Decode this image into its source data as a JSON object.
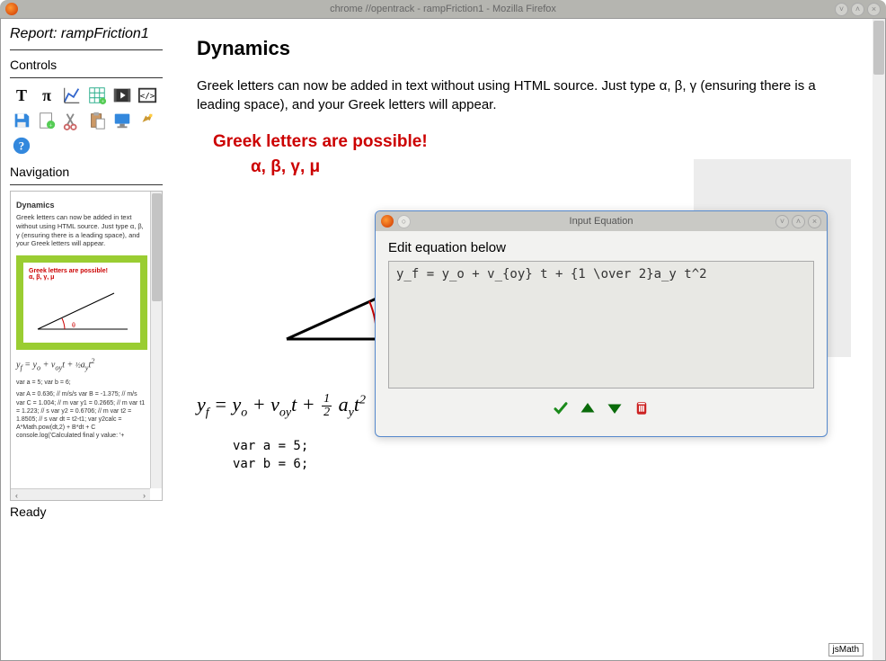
{
  "window": {
    "title": "chrome //opentrack - rampFriction1 - Mozilla Firefox"
  },
  "sidebar": {
    "report_label": "Report: rampFriction1",
    "controls_label": "Controls",
    "navigation_label": "Navigation",
    "status": "Ready"
  },
  "nav": {
    "title": "Dynamics",
    "para": "Greek letters can now be added in text without using HTML source. Just type α, β, γ (ensuring there is a leading space), and your Greek letters will appear.",
    "preview_red1": "Greek letters are possible!",
    "preview_red2": "α, β, γ, μ",
    "preview_angle": "θ",
    "eq": "yf = yo + voyt + ½ayt²",
    "code1": "var a = 5; var b = 6;",
    "code2": "var A = 0.636; // m/s/s var B = -1.375; // m/s var C = 1.004; // m var y1 = 0.2665; // m var t1 = 1.223; // s var y2 = 0.6706; // m var t2 = 1.8505; // s var dt = t2-t1; var y2calc = A*Math.pow(dt,2) + B*dt + C console.log('Calculated final y value: '+"
  },
  "main": {
    "heading": "Dynamics",
    "para": "Greek letters can now be added in text without using HTML source.  Just type α, β, γ (ensuring there is a leading space), and your Greek letters will appear.",
    "callout1": "Greek letters are possible!",
    "callout2": "α, β, γ, μ",
    "code_line1": "var a = 5;",
    "code_line2": "var b = 6;",
    "jsmath": "jsMath"
  },
  "equation": {
    "lhs": "y",
    "lhs_sub": "f",
    "eq_sign": " = ",
    "t1": "y",
    "t1_sub": "o",
    "plus1": " + ",
    "t2": "v",
    "t2_sub": "oy",
    "t2_var": "t",
    "plus2": " + ",
    "frac_num": "1",
    "frac_den": "2",
    "t3": "a",
    "t3_sub": "y",
    "t3_var": "t",
    "t3_sup": "2"
  },
  "dialog": {
    "title": "Input Equation",
    "label": "Edit equation below",
    "value": "y_f = y_o + v_{oy} t + {1 \\over 2}a_y t^2"
  }
}
